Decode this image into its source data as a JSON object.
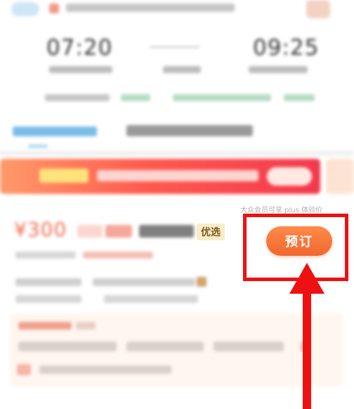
{
  "flight": {
    "departure_time": "07:20",
    "arrival_time": "09:25"
  },
  "offer": {
    "price": "¥300",
    "selection_badge": "优选",
    "member_note": "大众会员可享 plus 体验价",
    "book_label": "预订"
  },
  "colors": {
    "book_button": "#f0672d",
    "price": "#f26b50",
    "highlight": "#ee1111",
    "promo_banner": "#f2394d"
  },
  "icons": {
    "arrow": "red-up-arrow"
  }
}
